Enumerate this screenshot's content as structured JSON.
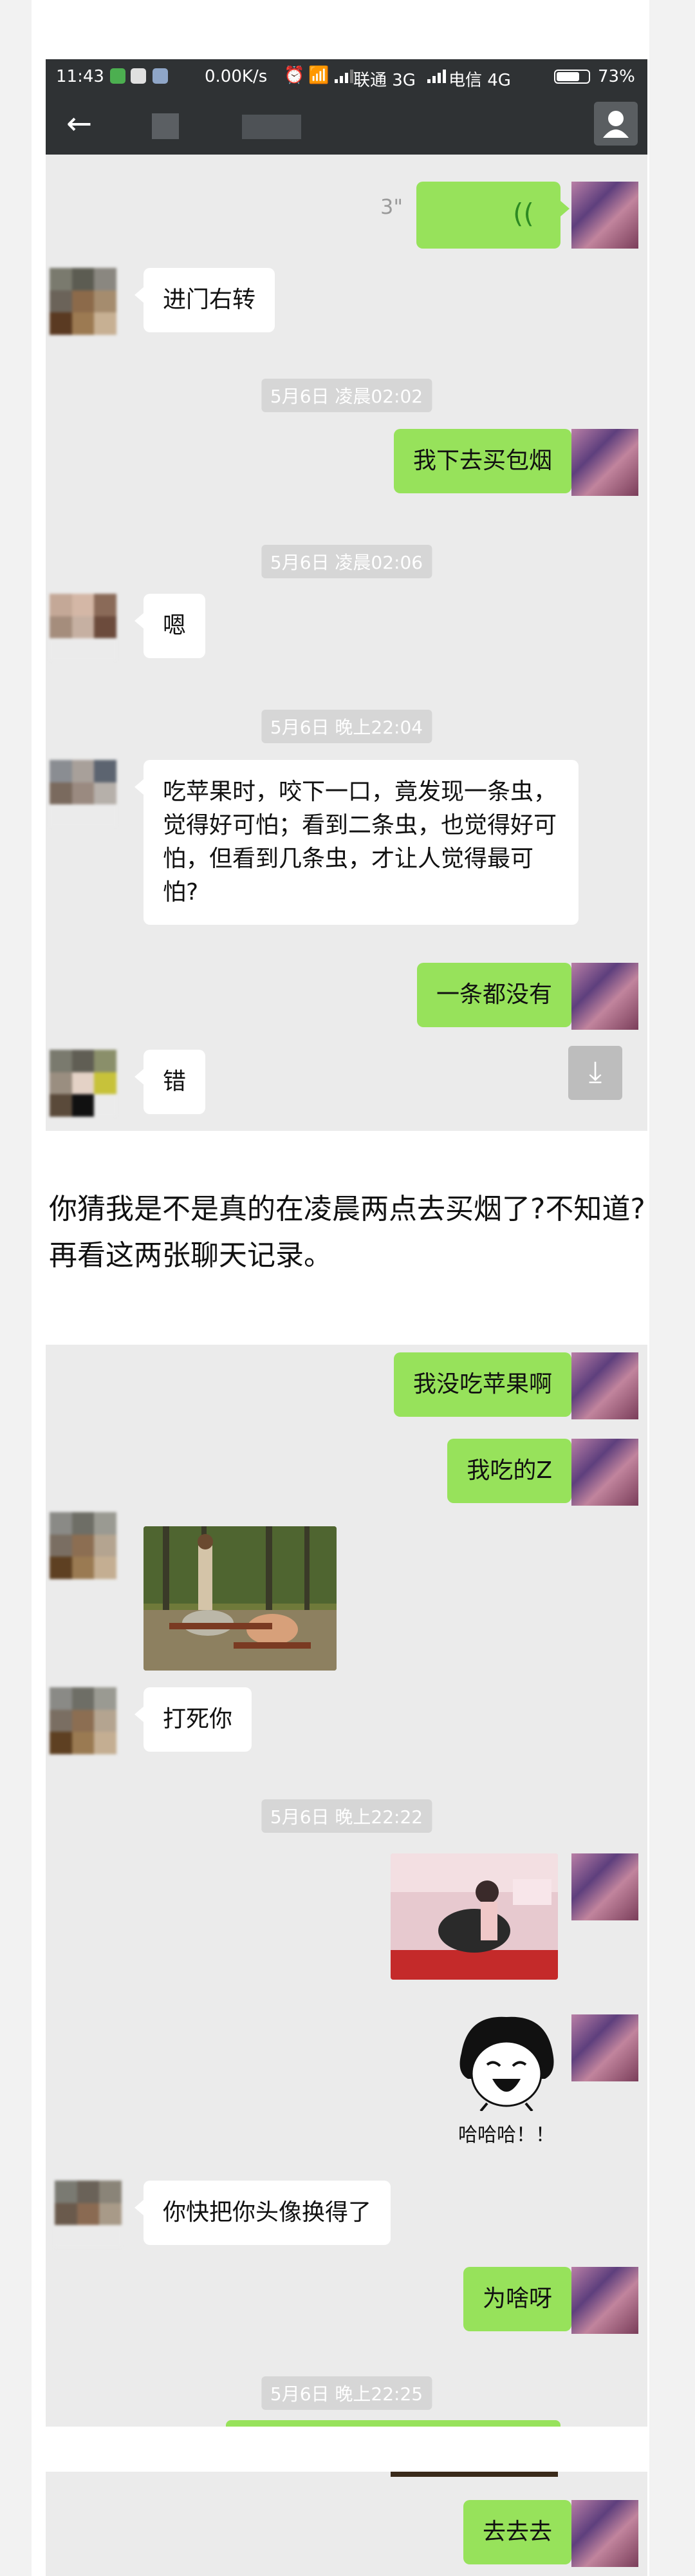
{
  "status_bar": {
    "time": "11:43",
    "net_speed": "0.00K/s",
    "carrier1": "联通 3G",
    "carrier2": "电信 4G",
    "battery_pct": "73%",
    "battery_level": 0.73
  },
  "title_bar": {
    "back_icon": "arrow-left-icon",
    "user_icon": "user-icon"
  },
  "chat1": {
    "voice_duration": "3\"",
    "messages": [
      {
        "text": "进门右转"
      },
      {
        "timestamp": "5月6日 凌晨02:02"
      },
      {
        "text": "我下去买包烟"
      },
      {
        "timestamp": "5月6日 凌晨02:06"
      },
      {
        "text": "嗯"
      },
      {
        "timestamp": "5月6日 晚上22:04"
      },
      {
        "text": "吃苹果时，咬下一口，竟发现一条虫，觉得好可怕；看到二条虫，也觉得好可怕，但看到几条虫，才让人觉得最可怕?"
      },
      {
        "text": "一条都没有"
      },
      {
        "text": "错"
      }
    ]
  },
  "article_text": "你猜我是不是真的在凌晨两点去买烟了?不知道?再看这两张聊天记录。",
  "chat2": {
    "messages": [
      {
        "text": "我没吃苹果啊"
      },
      {
        "text": "我吃的Z"
      },
      {
        "text": "打死你"
      },
      {
        "timestamp": "5月6日 晚上22:22"
      },
      {
        "sticker_caption": "哈哈哈！！"
      },
      {
        "text": "你快把你头像换得了"
      },
      {
        "text": "为啥呀"
      },
      {
        "timestamp": "5月6日 晚上22:25"
      }
    ]
  },
  "chat3": {
    "messages": [
      {
        "text": "去去去"
      }
    ]
  },
  "colors": {
    "bubble_green": "#97e25b",
    "titlebar": "#2f3234",
    "chat_bg": "#ebebeb"
  }
}
